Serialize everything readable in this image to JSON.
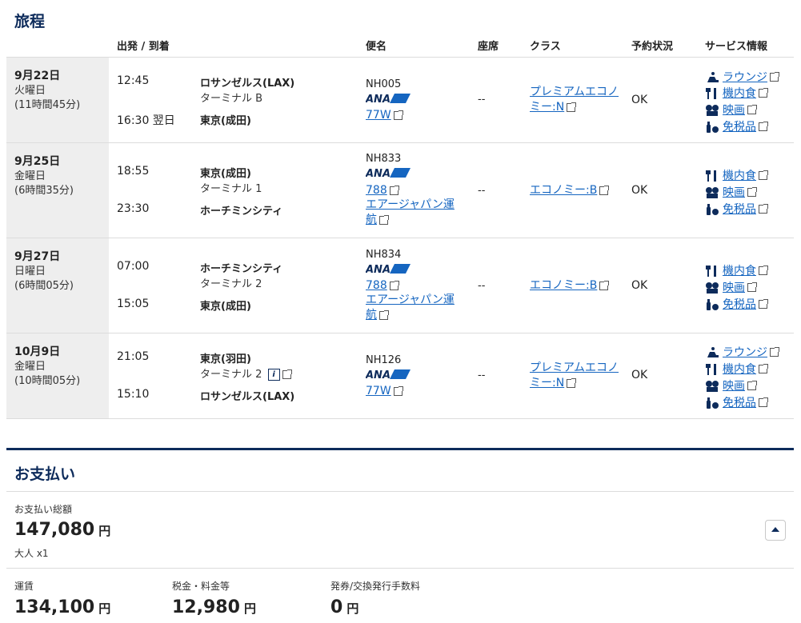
{
  "itinerary": {
    "title": "旅程",
    "headers": {
      "depart_arrive": "出発 / 到着",
      "flight": "便名",
      "seat": "座席",
      "class": "クラス",
      "status": "予約状況",
      "services": "サービス情報"
    },
    "rows": [
      {
        "date": "9月22日",
        "weekday": "火曜日",
        "duration": "(11時間45分)",
        "dep_time": "12:45",
        "dep_city": "ロサンゼルス(LAX)",
        "dep_terminal": "ターミナル B",
        "arr_time": "16:30 翌日",
        "arr_city": "東京(成田)",
        "flight_no": "NH005",
        "aircraft": "77W",
        "operator_1": "",
        "operator_2": "",
        "seat": "--",
        "class_1": "プレミアムエコノ",
        "class_2": "ミー:N",
        "status": "OK",
        "services": [
          "ラウンジ",
          "機内食",
          "映画",
          "免税品"
        ]
      },
      {
        "date": "9月25日",
        "weekday": "金曜日",
        "duration": "(6時間35分)",
        "dep_time": "18:55",
        "dep_city": "東京(成田)",
        "dep_terminal": "ターミナル 1",
        "arr_time": "23:30",
        "arr_city": "ホーチミンシティ",
        "flight_no": "NH833",
        "aircraft": "788",
        "operator_1": "エアージャパン運",
        "operator_2": "航",
        "seat": "--",
        "class_1": "エコノミー:B",
        "class_2": "",
        "status": "OK",
        "services": [
          "機内食",
          "映画",
          "免税品"
        ]
      },
      {
        "date": "9月27日",
        "weekday": "日曜日",
        "duration": "(6時間05分)",
        "dep_time": "07:00",
        "dep_city": "ホーチミンシティ",
        "dep_terminal": "ターミナル 2",
        "arr_time": "15:05",
        "arr_city": "東京(成田)",
        "flight_no": "NH834",
        "aircraft": "788",
        "operator_1": "エアージャパン運",
        "operator_2": "航",
        "seat": "--",
        "class_1": "エコノミー:B",
        "class_2": "",
        "status": "OK",
        "services": [
          "機内食",
          "映画",
          "免税品"
        ]
      },
      {
        "date": "10月9日",
        "weekday": "金曜日",
        "duration": "(10時間05分)",
        "dep_time": "21:05",
        "dep_city": "東京(羽田)",
        "dep_terminal": "ターミナル 2",
        "arr_time": "15:10",
        "arr_city": "ロサンゼルス(LAX)",
        "flight_no": "NH126",
        "aircraft": "77W",
        "operator_1": "",
        "operator_2": "",
        "seat": "--",
        "class_1": "プレミアムエコノ",
        "class_2": "ミー:N",
        "status": "OK",
        "services": [
          "ラウンジ",
          "機内食",
          "映画",
          "免税品"
        ]
      }
    ],
    "airline_logo": "ANA"
  },
  "payment": {
    "title": "お支払い",
    "total_label": "お支払い総額",
    "total_amount": "147,080",
    "currency": "円",
    "passengers": "大人 x1",
    "fare_label": "運賃",
    "fare_amount": "134,100",
    "tax_label": "税金・料金等",
    "tax_amount": "12,980",
    "fee_label": "発券/交換発行手数料",
    "fee_amount": "0"
  },
  "colors": {
    "navy": "#0d2b5b",
    "link": "#1565c0",
    "date_bg": "#eeeeee"
  },
  "icons": {
    "lounge": "lounge-icon",
    "meal": "meal-icon",
    "movie": "movie-icon",
    "dutyfree": "dutyfree-icon",
    "info": "info-icon",
    "external": "external-link-icon",
    "collapse": "chevron-up-icon"
  }
}
